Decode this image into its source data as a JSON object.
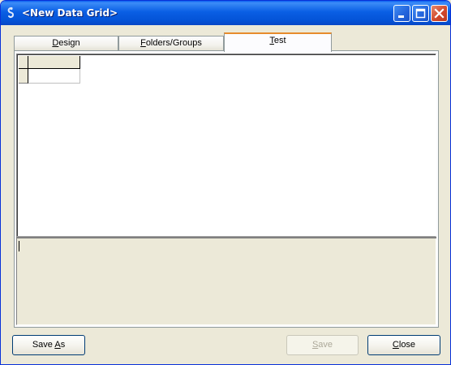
{
  "window": {
    "title": "<New Data Grid>",
    "icon": "app-hook-icon"
  },
  "title_buttons": {
    "minimize_icon": "minimize-icon",
    "maximize_icon": "maximize-icon",
    "close_icon": "close-icon"
  },
  "tabs": [
    {
      "label_pre": "",
      "label_key": "D",
      "label_post": "esign",
      "active": false
    },
    {
      "label_pre": "",
      "label_key": "F",
      "label_post": "olders/Groups",
      "active": false
    },
    {
      "label_pre": "",
      "label_key": "T",
      "label_post": "est",
      "active": true
    }
  ],
  "grid": {
    "columns": [
      ""
    ],
    "rows": [
      [
        ""
      ]
    ]
  },
  "query_text": "",
  "buttons": {
    "save_as": {
      "pre": "Save ",
      "key": "A",
      "post": "s",
      "enabled": true
    },
    "save": {
      "pre": "",
      "key": "S",
      "post": "ave",
      "enabled": false
    },
    "close": {
      "pre": "",
      "key": "C",
      "post": "lose",
      "enabled": true
    }
  },
  "colors": {
    "title_bar": "#0a5fe4",
    "window_bg": "#ece9d8",
    "active_tab_accent": "#e68b2c"
  }
}
